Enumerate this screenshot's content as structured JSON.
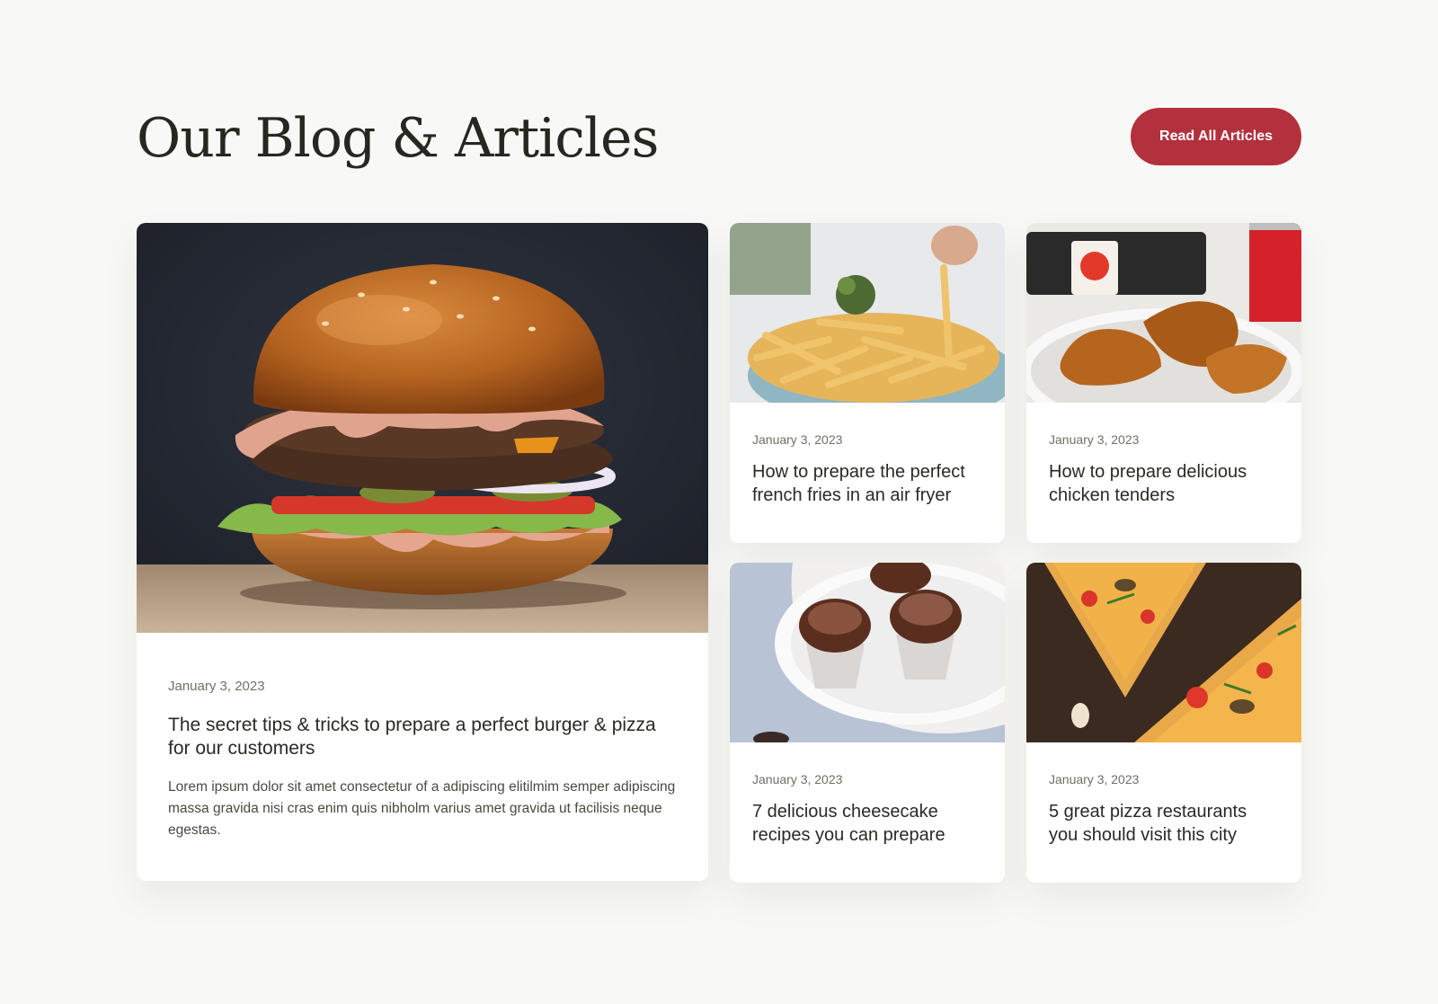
{
  "header": {
    "title": "Our Blog & Articles",
    "cta_label": "Read All Articles"
  },
  "featured": {
    "image": "burger-photo",
    "date": "January 3, 2023",
    "title": "The secret tips & tricks to prepare a perfect burger & pizza for our customers",
    "excerpt": "Lorem ipsum dolor sit amet consectetur of a adipiscing elitilmim semper adipiscing massa gravida nisi cras enim quis nibholm varius amet gravida ut facilisis neque egestas."
  },
  "articles": [
    {
      "image": "french-fries-photo",
      "date": "January 3, 2023",
      "title": "How to prepare the perfect french fries in an air fryer"
    },
    {
      "image": "chicken-tenders-photo",
      "date": "January 3, 2023",
      "title": "How to prepare delicious chicken tenders"
    },
    {
      "image": "cupcakes-photo",
      "date": "January 3, 2023",
      "title": "7 delicious cheesecake recipes you can prepare"
    },
    {
      "image": "pizza-photo",
      "date": "January 3, 2023",
      "title": "5 great pizza restaurants you should visit this city"
    }
  ],
  "colors": {
    "page_background": "#f8f8f6",
    "accent": "#b3303d",
    "card_background": "#ffffff",
    "heading": "#27271f",
    "muted_text": "#6f6f66"
  }
}
